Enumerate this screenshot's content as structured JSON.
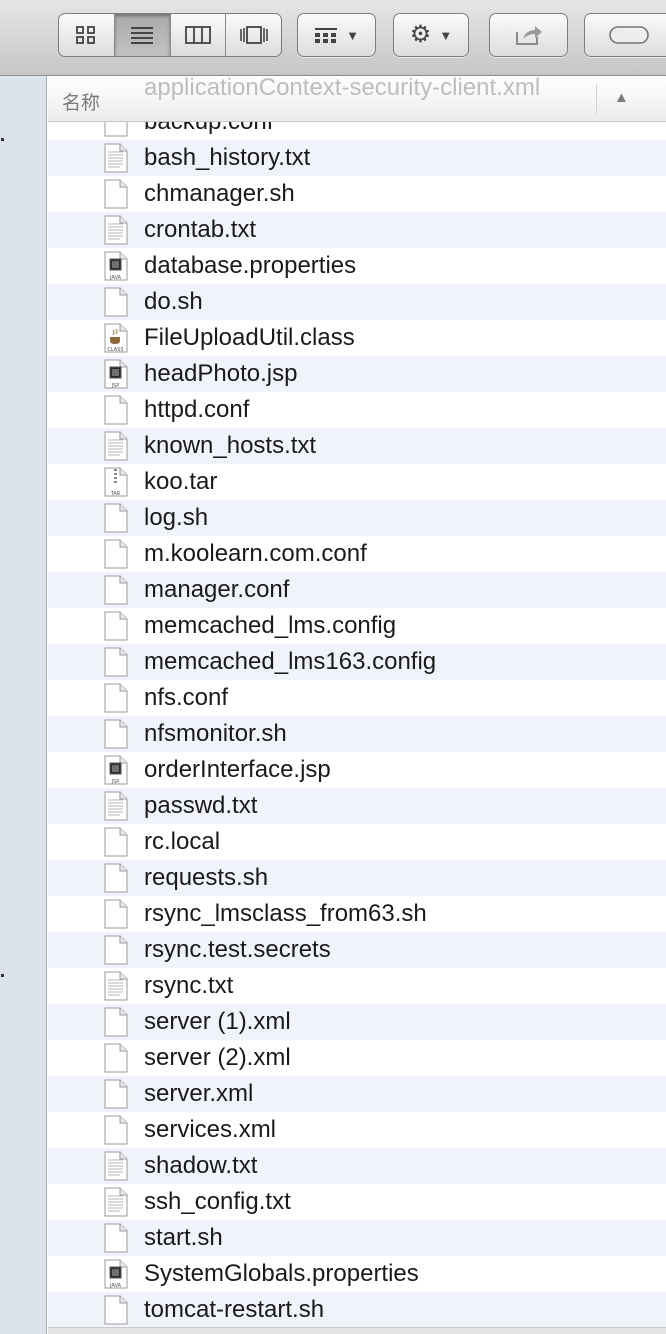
{
  "toolbar": {
    "view_buttons": [
      "icon-view",
      "list-view",
      "column-view",
      "cover-flow-view"
    ],
    "active_view": "list-view",
    "arrange_icon": "arrange-icon",
    "action_icon": "gear-icon",
    "share_icon": "share-icon",
    "toggle_icon": "toolbar-toggle-icon"
  },
  "header": {
    "name_column": "名称",
    "ghost_row": "applicationContext-security-client.xml",
    "sort_indicator": "▲"
  },
  "files": [
    {
      "name": "backup.conf",
      "icon": "doc"
    },
    {
      "name": "bash_history.txt",
      "icon": "txt"
    },
    {
      "name": "chmanager.sh",
      "icon": "doc"
    },
    {
      "name": "crontab.txt",
      "icon": "txt"
    },
    {
      "name": "database.properties",
      "icon": "java"
    },
    {
      "name": "do.sh",
      "icon": "doc"
    },
    {
      "name": "FileUploadUtil.class",
      "icon": "class"
    },
    {
      "name": "headPhoto.jsp",
      "icon": "jsp"
    },
    {
      "name": "httpd.conf",
      "icon": "doc"
    },
    {
      "name": "known_hosts.txt",
      "icon": "txt"
    },
    {
      "name": "koo.tar",
      "icon": "tar"
    },
    {
      "name": "log.sh",
      "icon": "doc"
    },
    {
      "name": "m.koolearn.com.conf",
      "icon": "doc"
    },
    {
      "name": "manager.conf",
      "icon": "doc"
    },
    {
      "name": "memcached_lms.config",
      "icon": "doc"
    },
    {
      "name": "memcached_lms163.config",
      "icon": "doc"
    },
    {
      "name": "nfs.conf",
      "icon": "doc"
    },
    {
      "name": "nfsmonitor.sh",
      "icon": "doc"
    },
    {
      "name": "orderInterface.jsp",
      "icon": "jsp"
    },
    {
      "name": "passwd.txt",
      "icon": "txt"
    },
    {
      "name": "rc.local",
      "icon": "doc"
    },
    {
      "name": "requests.sh",
      "icon": "doc"
    },
    {
      "name": "rsync_lmsclass_from63.sh",
      "icon": "doc"
    },
    {
      "name": "rsync.test.secrets",
      "icon": "doc"
    },
    {
      "name": "rsync.txt",
      "icon": "txt"
    },
    {
      "name": "server (1).xml",
      "icon": "doc"
    },
    {
      "name": "server (2).xml",
      "icon": "doc"
    },
    {
      "name": "server.xml",
      "icon": "doc"
    },
    {
      "name": "services.xml",
      "icon": "doc"
    },
    {
      "name": "shadow.txt",
      "icon": "txt"
    },
    {
      "name": "ssh_config.txt",
      "icon": "txt"
    },
    {
      "name": "start.sh",
      "icon": "doc"
    },
    {
      "name": "SystemGlobals.properties",
      "icon": "java"
    },
    {
      "name": "tomcat-restart.sh",
      "icon": "doc"
    }
  ],
  "icon_badges": {
    "java": "JAVA",
    "jsp": "JSP",
    "class": "CLASS",
    "tar": "TAR"
  }
}
